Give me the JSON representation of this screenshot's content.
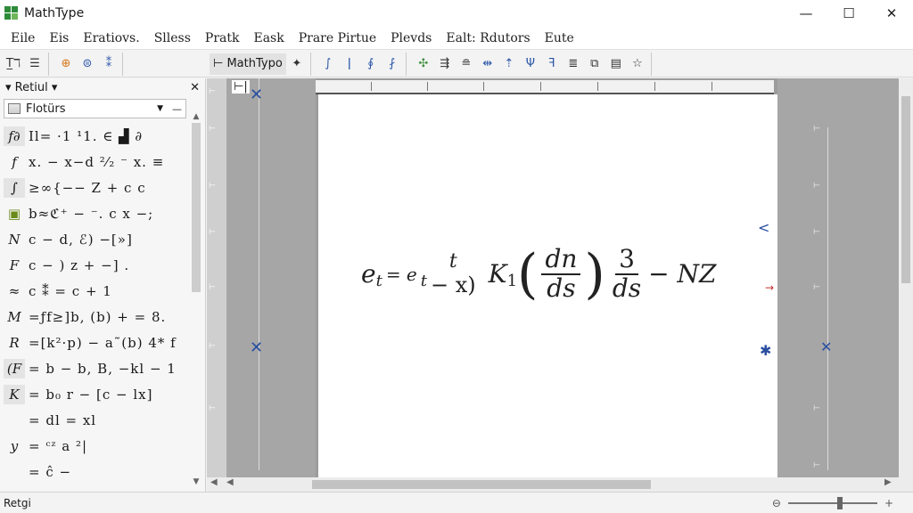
{
  "app": {
    "title": "MathType"
  },
  "window_controls": {
    "minimize": "—",
    "maximize": "☐",
    "close": "✕"
  },
  "menu": [
    "Eile",
    "Eis",
    "Eratiovs.",
    "Slless",
    "Pratk",
    "Eask",
    "Prare Pirtue",
    "Plevds",
    "Ealt: Rdutors",
    "Eute"
  ],
  "toolbar": {
    "label": "MathTypo"
  },
  "left_panel": {
    "header": "Retiul",
    "close": "✕",
    "category": "Flotürs",
    "rows": [
      {
        "sym": "f∂",
        "expr": "Il= ·1  ¹1.  ∈  ▟  ∂"
      },
      {
        "sym": "f",
        "expr": "x. − x−d ²⁄₂ ⁻ x. ≡"
      },
      {
        "sym": "∫",
        "expr": "≥∞{−− Z + c  c"
      },
      {
        "sym": "▣",
        "expr": "b≈ℭ⁺ − ⁻. c  x −;"
      },
      {
        "sym": "N",
        "expr": "c − d, ℰ) −[»]"
      },
      {
        "sym": "F",
        "expr": "c − ) z + −]   ."
      },
      {
        "sym": "≈",
        "expr": "c  ⁑  = c  +  1"
      },
      {
        "sym": "M",
        "expr": "=ƒf≥]b, (b)  +  =  8."
      },
      {
        "sym": "R",
        "expr": "=[k²·p) − a˜(b) 4* f"
      },
      {
        "sym": "(F",
        "expr": "= b − b, B, −kl −  1"
      },
      {
        "sym": "K",
        "expr": "= b₀ r − [c − lx]"
      },
      {
        "sym": "",
        "expr": "= dl = xl"
      },
      {
        "sym": "y",
        "expr": "= ᶜᶻ a ²|"
      },
      {
        "sym": "",
        "expr": "= ĉ −"
      }
    ]
  },
  "equation": {
    "e": "e",
    "e_sub": "t",
    "eq": "= e",
    "e2_sub": "t",
    "frac1_num": "t",
    "frac1_den": "− x)",
    "K": "K",
    "K_sub": "1",
    "frac2_num": "dn",
    "frac2_den": "ds",
    "frac3_num": "3",
    "frac3_den": "ds",
    "tail": "− NZ"
  },
  "status": {
    "text": "Retgi"
  },
  "zoom": {
    "minus": "⊖",
    "plus": "+",
    "fraction": 0.58
  }
}
